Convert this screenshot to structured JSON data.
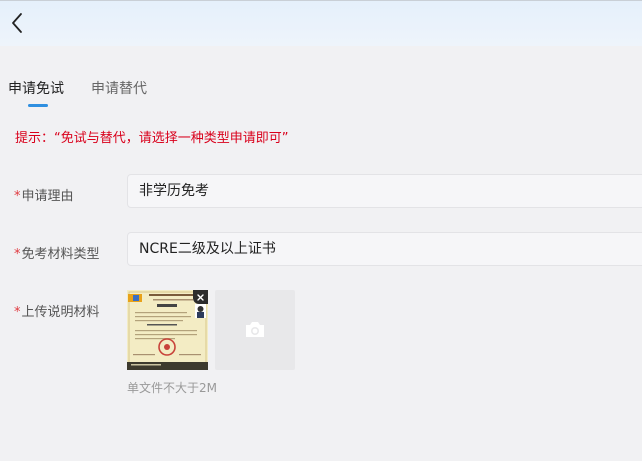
{
  "header": {
    "back_icon": "chevron-left-icon"
  },
  "tabs": [
    {
      "label": "申请免试",
      "active": true
    },
    {
      "label": "申请替代",
      "active": false
    }
  ],
  "hint": "提示：“免试与替代，请选择一种类型申请即可”",
  "form": {
    "required_mark": "*",
    "reason": {
      "label": "申请理由",
      "value": "非学历免考"
    },
    "material_type": {
      "label": "免考材料类型",
      "value": "NCRE二级及以上证书"
    },
    "upload": {
      "label": "上传说明材料",
      "size_tip": "单文件不大于2M",
      "thumbnail_icon": "certificate-image",
      "delete_icon": "close-icon",
      "add_icon": "camera-icon"
    }
  },
  "colors": {
    "accent": "#2f8fe0",
    "hint": "#d9001b",
    "required": "#e0383e"
  }
}
